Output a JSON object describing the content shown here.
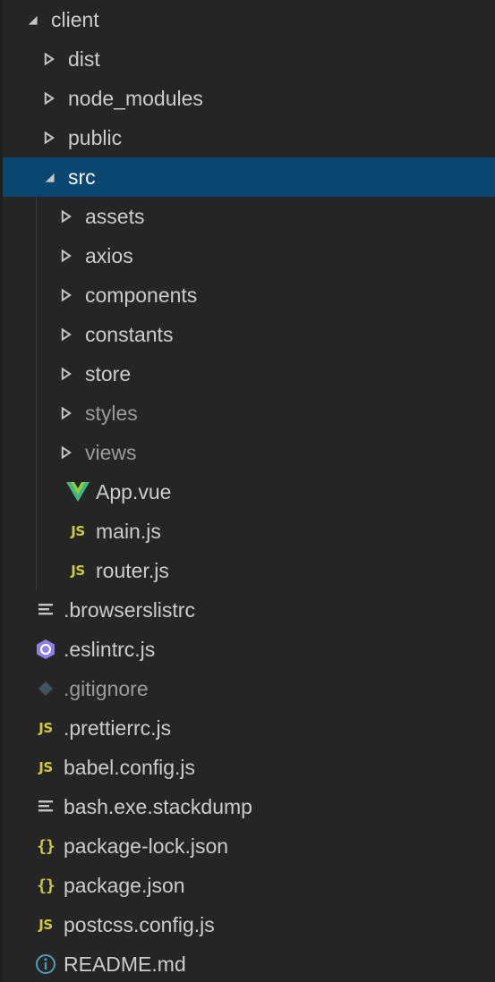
{
  "explorer": {
    "items": [
      {
        "label": "client",
        "kind": "folder",
        "expanded": true,
        "depth": 0,
        "icon": "chevron-down-icon"
      },
      {
        "label": "dist",
        "kind": "folder",
        "expanded": false,
        "depth": 1,
        "icon": "chevron-right-icon"
      },
      {
        "label": "node_modules",
        "kind": "folder",
        "expanded": false,
        "depth": 1,
        "icon": "chevron-right-icon"
      },
      {
        "label": "public",
        "kind": "folder",
        "expanded": false,
        "depth": 1,
        "icon": "chevron-right-icon"
      },
      {
        "label": "src",
        "kind": "folder",
        "expanded": true,
        "depth": 1,
        "selected": true,
        "icon": "chevron-down-icon"
      },
      {
        "label": "assets",
        "kind": "folder",
        "expanded": false,
        "depth": 2,
        "icon": "chevron-right-icon"
      },
      {
        "label": "axios",
        "kind": "folder",
        "expanded": false,
        "depth": 2,
        "icon": "chevron-right-icon"
      },
      {
        "label": "components",
        "kind": "folder",
        "expanded": false,
        "depth": 2,
        "icon": "chevron-right-icon"
      },
      {
        "label": "constants",
        "kind": "folder",
        "expanded": false,
        "depth": 2,
        "icon": "chevron-right-icon"
      },
      {
        "label": "store",
        "kind": "folder",
        "expanded": false,
        "depth": 2,
        "icon": "chevron-right-icon"
      },
      {
        "label": "styles",
        "kind": "folder",
        "expanded": false,
        "depth": 2,
        "dim": true,
        "icon": "chevron-right-icon"
      },
      {
        "label": "views",
        "kind": "folder",
        "expanded": false,
        "depth": 2,
        "dim": true,
        "icon": "chevron-right-icon"
      },
      {
        "label": "App.vue",
        "kind": "file",
        "depth": 2,
        "icon": "vue-icon"
      },
      {
        "label": "main.js",
        "kind": "file",
        "depth": 2,
        "icon": "js-icon",
        "icon_text": "JS"
      },
      {
        "label": "router.js",
        "kind": "file",
        "depth": 2,
        "icon": "js-icon",
        "icon_text": "JS"
      },
      {
        "label": ".browserslistrc",
        "kind": "file",
        "depth": 1,
        "icon": "lines-icon"
      },
      {
        "label": ".eslintrc.js",
        "kind": "file",
        "depth": 1,
        "icon": "eslint-icon"
      },
      {
        "label": ".gitignore",
        "kind": "file",
        "depth": 1,
        "dim": true,
        "icon": "git-icon"
      },
      {
        "label": ".prettierrc.js",
        "kind": "file",
        "depth": 1,
        "icon": "js-icon",
        "icon_text": "JS"
      },
      {
        "label": "babel.config.js",
        "kind": "file",
        "depth": 1,
        "icon": "js-icon",
        "icon_text": "JS"
      },
      {
        "label": "bash.exe.stackdump",
        "kind": "file",
        "depth": 1,
        "icon": "lines-icon"
      },
      {
        "label": "package-lock.json",
        "kind": "file",
        "depth": 1,
        "icon": "json-icon",
        "icon_text": "{}"
      },
      {
        "label": "package.json",
        "kind": "file",
        "depth": 1,
        "icon": "json-icon",
        "icon_text": "{}"
      },
      {
        "label": "postcss.config.js",
        "kind": "file",
        "depth": 1,
        "icon": "js-icon",
        "icon_text": "JS"
      },
      {
        "label": "README.md",
        "kind": "file",
        "depth": 1,
        "icon": "info-icon"
      }
    ]
  },
  "colors": {
    "background": "#252526",
    "selection": "#094771",
    "text": "#cccccc",
    "js": "#cbcb41",
    "vue_green": "#41b883",
    "eslint_purple": "#8f7ee7",
    "info_blue": "#519aba",
    "git_gray": "#41535b"
  }
}
